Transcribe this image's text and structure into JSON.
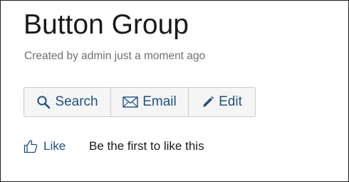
{
  "page": {
    "title": "Button Group",
    "byline": "Created by admin just a moment ago"
  },
  "buttons": {
    "search_label": "Search",
    "email_label": "Email",
    "edit_label": "Edit"
  },
  "likes": {
    "like_label": "Like",
    "like_summary": "Be the first to like this"
  },
  "icons": {
    "search": "search-icon",
    "email": "envelope-icon",
    "edit": "pencil-icon",
    "like": "thumbs-up-icon"
  },
  "colors": {
    "link": "#205081",
    "title": "#1a1a1a",
    "meta": "#707070",
    "button_bg": "#f5f5f5",
    "button_border": "#cccccc"
  }
}
